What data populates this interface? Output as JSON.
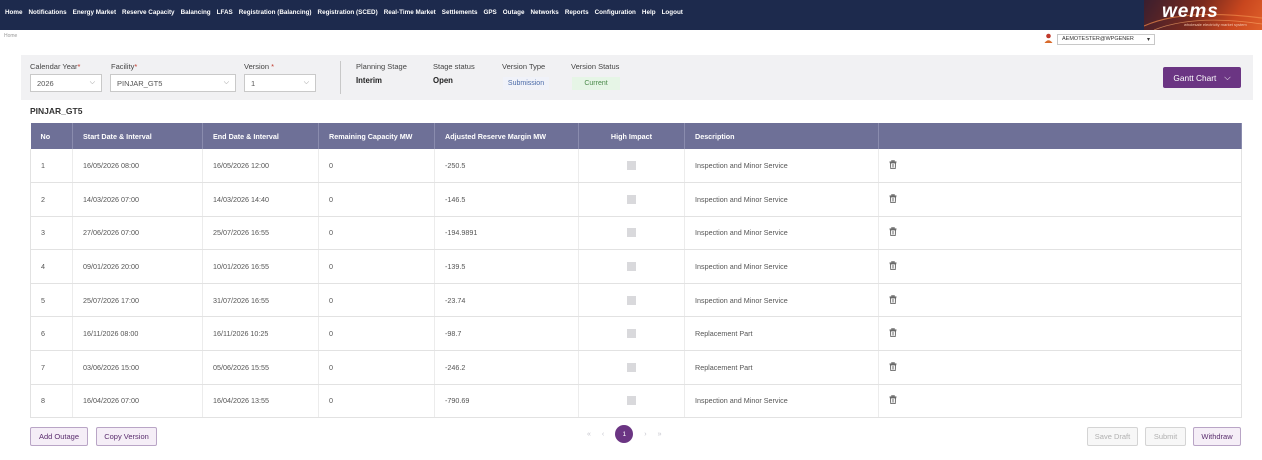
{
  "nav": [
    "Home",
    "Notifications",
    "Energy Market",
    "Reserve Capacity",
    "Balancing",
    "LFAS",
    "Registration (Balancing)",
    "Registration (SCED)",
    "Real-Time Market",
    "Settlements",
    "GPS",
    "Outage",
    "Networks",
    "Reports",
    "Configuration",
    "Help",
    "Logout"
  ],
  "brand": {
    "logo_text": "wems",
    "tagline": "wholesale electricity market system"
  },
  "breadcrumb": "Home",
  "user": {
    "name": "AEMOTESTER@WPGENER",
    "icon": "user-icon"
  },
  "filters": {
    "calendar_year": {
      "label": "Calendar Year",
      "value": "2026"
    },
    "facility": {
      "label": "Facility",
      "value": "PINJAR_GT5"
    },
    "version": {
      "label": "Version",
      "value": "1"
    },
    "required_mark": "*"
  },
  "info": {
    "planning_stage": {
      "label": "Planning Stage",
      "value": "Interim"
    },
    "stage_status": {
      "label": "Stage status",
      "value": "Open"
    },
    "version_type": {
      "label": "Version Type",
      "value": "Submission"
    },
    "version_status": {
      "label": "Version Status",
      "value": "Current"
    }
  },
  "gantt_label": "Gantt Chart",
  "facility_title": "PINJAR_GT5",
  "table": {
    "columns": [
      "No",
      "Start Date & Interval",
      "End Date & Interval",
      "Remaining Capacity MW",
      "Adjusted Reserve Margin MW",
      "High Impact",
      "Description",
      ""
    ],
    "rows": [
      {
        "no": "1",
        "start": "16/05/2026 08:00",
        "end": "16/05/2026 12:00",
        "remaining": "0",
        "margin": "-250.5",
        "desc": "Inspection and Minor Service"
      },
      {
        "no": "2",
        "start": "14/03/2026 07:00",
        "end": "14/03/2026 14:40",
        "remaining": "0",
        "margin": "-146.5",
        "desc": "Inspection and Minor Service"
      },
      {
        "no": "3",
        "start": "27/06/2026 07:00",
        "end": "25/07/2026 16:55",
        "remaining": "0",
        "margin": "-194.9891",
        "desc": "Inspection and Minor Service"
      },
      {
        "no": "4",
        "start": "09/01/2026 20:00",
        "end": "10/01/2026 16:55",
        "remaining": "0",
        "margin": "-139.5",
        "desc": "Inspection and Minor Service"
      },
      {
        "no": "5",
        "start": "25/07/2026 17:00",
        "end": "31/07/2026 16:55",
        "remaining": "0",
        "margin": "-23.74",
        "desc": "Inspection and Minor Service"
      },
      {
        "no": "6",
        "start": "16/11/2026 08:00",
        "end": "16/11/2026 10:25",
        "remaining": "0",
        "margin": "-98.7",
        "desc": "Replacement Part"
      },
      {
        "no": "7",
        "start": "03/06/2026 15:00",
        "end": "05/06/2026 15:55",
        "remaining": "0",
        "margin": "-246.2",
        "desc": "Replacement Part"
      },
      {
        "no": "8",
        "start": "16/04/2026 07:00",
        "end": "16/04/2026 13:55",
        "remaining": "0",
        "margin": "-790.69",
        "desc": "Inspection and Minor Service"
      }
    ]
  },
  "actions": {
    "add_outage": "Add Outage",
    "copy_version": "Copy Version",
    "save_draft": "Save Draft",
    "submit": "Submit",
    "withdraw": "Withdraw"
  },
  "pagination": {
    "first": "«",
    "prev": "‹",
    "current": "1",
    "next": "›",
    "last": "»"
  },
  "colors": {
    "header_bg": "#1d2a4d",
    "accent": "#6b3583",
    "table_header": "#6e7097"
  }
}
